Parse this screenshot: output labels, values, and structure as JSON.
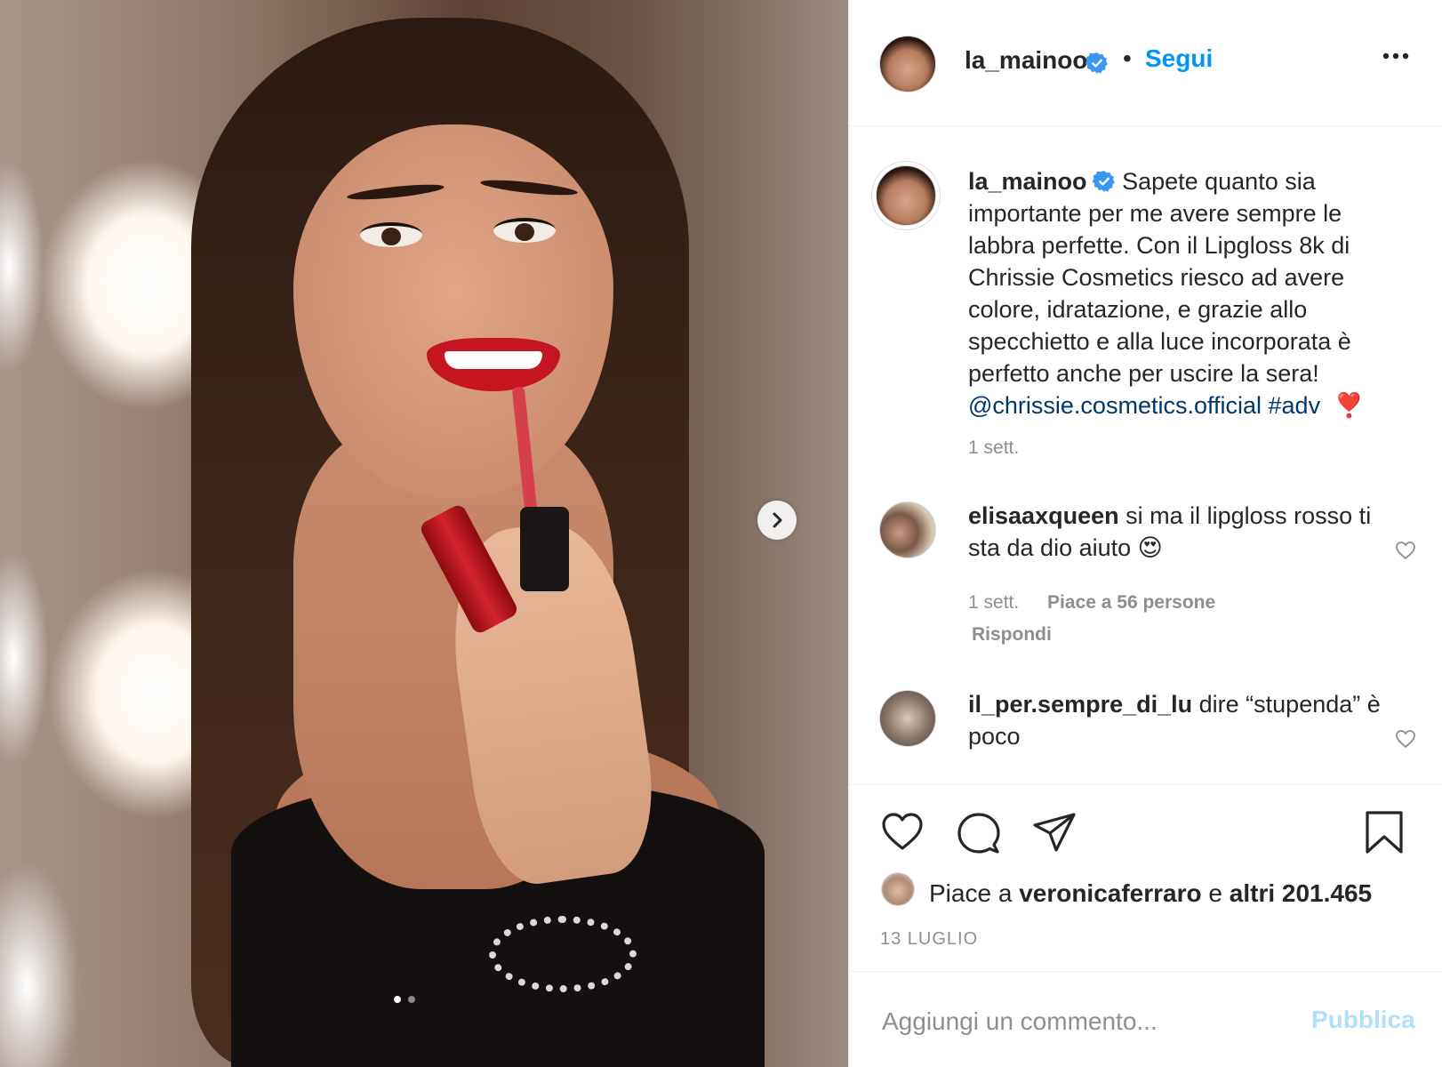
{
  "post": {
    "image_description_icon": "photo",
    "carousel": {
      "count": 2,
      "active_index": 0,
      "next_icon": "chevron-right-icon"
    }
  },
  "header": {
    "username": "la_mainoo",
    "verified": true,
    "separator": "•",
    "follow_label": "Segui",
    "more_icon": "more-horizontal-icon"
  },
  "caption": {
    "username": "la_mainoo",
    "text": "Sapete quanto sia importante per me avere sempre le labbra perfette. Con il Lipgloss 8k di Chrissie Cosmetics riesco ad avere colore, idratazione, e grazie allo specchietto e alla luce incorporata è perfetto anche per uscire la sera!",
    "mention": "@chrissie.cosmetics.official",
    "hashtag": "#adv",
    "emoji": "❣️",
    "time": "1 sett."
  },
  "comments": [
    {
      "username": "elisaaxqueen",
      "text": "si ma il lipgloss rosso ti sta da dio aiuto",
      "emoji": "😍",
      "time": "1 sett.",
      "likes": "Piace a 56 persone",
      "reply": "Rispondi"
    },
    {
      "username": "il_per.sempre_di_lu",
      "text": "dire “stupenda” è poco"
    }
  ],
  "actions": {
    "like_icon": "heart-icon",
    "comment_icon": "comment-icon",
    "share_icon": "send-icon",
    "save_icon": "bookmark-icon"
  },
  "likes": {
    "prefix": "Piace a",
    "user": "veronicaferraro",
    "connector": "e",
    "others": "altri 201.465"
  },
  "date": "13 LUGLIO",
  "add_comment": {
    "placeholder": "Aggiungi un commento...",
    "publish_label": "Pubblica"
  },
  "colors": {
    "link_blue": "#0095f6",
    "mention_blue": "#00376b",
    "verified_blue": "#3897f0",
    "publish_disabled": "#b2dffc",
    "muted": "#8e8e8e"
  }
}
